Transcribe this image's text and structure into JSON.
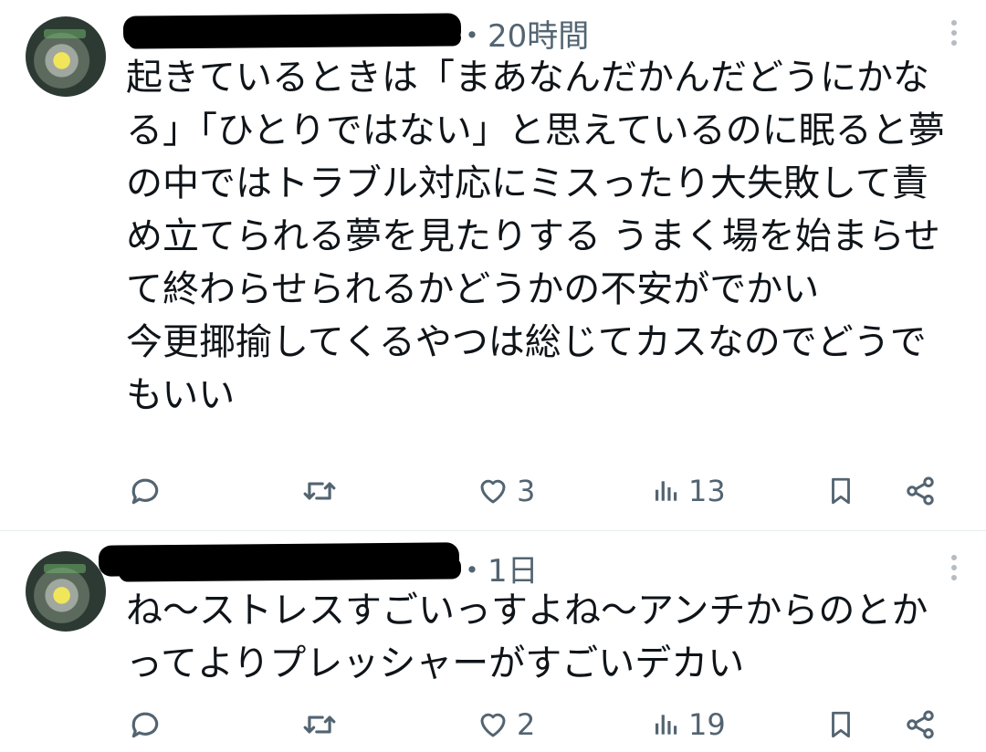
{
  "tweets": [
    {
      "time": "・20時間",
      "text": "起きているときは「まあなんだかんだどうにかなる」「ひとりではない」と思えているのに眠ると夢の中ではトラブル対応にミスったり大失敗して責め立てられる夢を見たりする うまく場を始まらせて終わらせられるかどうかの不安がでかい\n今更揶揄してくるやつは総じてカスなのでどうでもいい",
      "likes": "3",
      "views": "13"
    },
    {
      "time": "・1日",
      "text": "ね〜ストレスすごいっすよね〜アンチからのとかってよりプレッシャーがすごいデカい",
      "likes": "2",
      "views": "19"
    }
  ],
  "icons": {
    "reply": "reply-icon",
    "retweet": "retweet-icon",
    "like": "heart-icon",
    "views": "views-icon",
    "bookmark": "bookmark-icon",
    "share": "share-icon",
    "more": "more-icon"
  },
  "colors": {
    "text": "#0f1419",
    "muted": "#536471",
    "divider": "#e6ecf0"
  }
}
